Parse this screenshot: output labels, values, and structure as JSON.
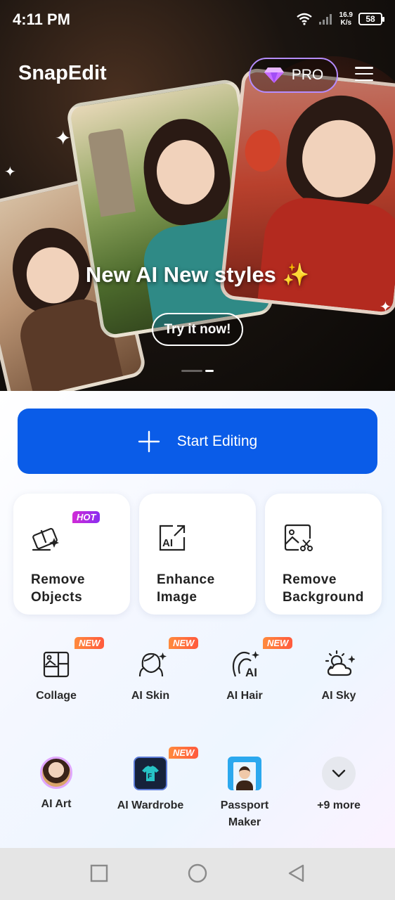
{
  "status": {
    "time": "4:11 PM",
    "net_speed_value": "16.9",
    "net_speed_unit": "K/s",
    "battery": "58"
  },
  "header": {
    "app_name": "SnapEdit",
    "pro_label": "PRO"
  },
  "hero": {
    "title": "New AI New styles ✨",
    "cta": "Try it now!"
  },
  "main": {
    "start_label": "Start Editing",
    "featured": [
      {
        "label": "Remove Objects",
        "badge": "HOT"
      },
      {
        "label": "Enhance Image"
      },
      {
        "label": "Remove Background"
      }
    ],
    "tools_row1": [
      {
        "label": "Collage",
        "badge": "NEW"
      },
      {
        "label": "AI Skin",
        "badge": "NEW"
      },
      {
        "label": "AI Hair",
        "badge": "NEW"
      },
      {
        "label": "AI Sky"
      }
    ],
    "tools_row2": [
      {
        "label": "AI Art"
      },
      {
        "label": "AI Wardrobe",
        "badge": "NEW"
      },
      {
        "label": "Passport Maker"
      },
      {
        "label": "+9 more"
      }
    ]
  },
  "colors": {
    "primary": "#0a5ce8",
    "hot": "#b02ce0",
    "new": "#ff6a3d"
  }
}
